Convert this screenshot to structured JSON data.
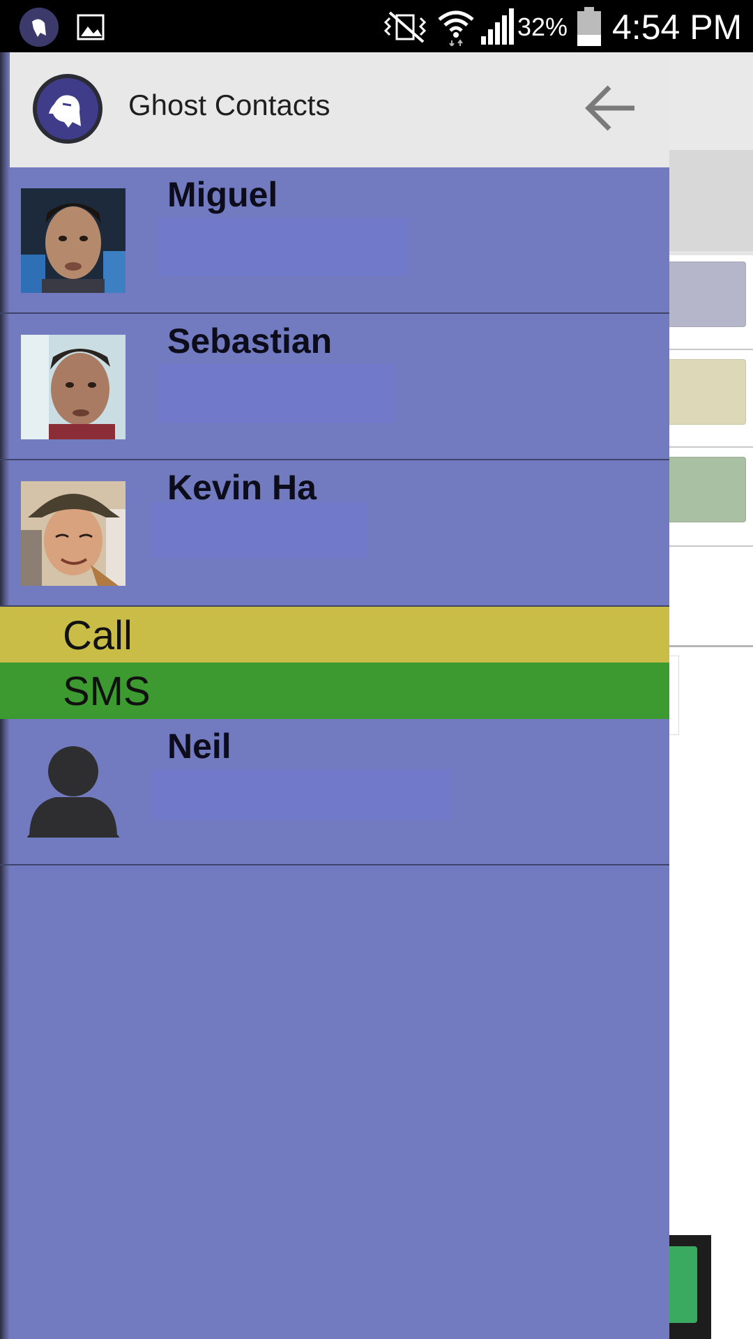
{
  "status_bar": {
    "battery_percent": "32%",
    "time": "4:54 PM",
    "icons": [
      "ghost-app-icon",
      "gallery-icon",
      "mute-vibrate-icon",
      "wifi-icon",
      "signal-icon",
      "battery-icon"
    ]
  },
  "drawer": {
    "title": "Ghost Contacts",
    "back_icon": "back-arrow-icon",
    "contacts": [
      {
        "name": "Miguel",
        "photo": "photo"
      },
      {
        "name": "Sebastian",
        "photo": "photo"
      },
      {
        "name": "Kevin Ha",
        "photo": "photo"
      },
      {
        "name": "Neil",
        "photo": "default-avatar"
      }
    ],
    "actions": {
      "call_label": "Call",
      "sms_label": "SMS"
    }
  },
  "colors": {
    "drawer_bg": "#727bbf",
    "header_bg": "#e8e8e8",
    "call_bg": "#c9bd48",
    "sms_bg": "#3c9a31",
    "redaction": "#7179ca"
  }
}
